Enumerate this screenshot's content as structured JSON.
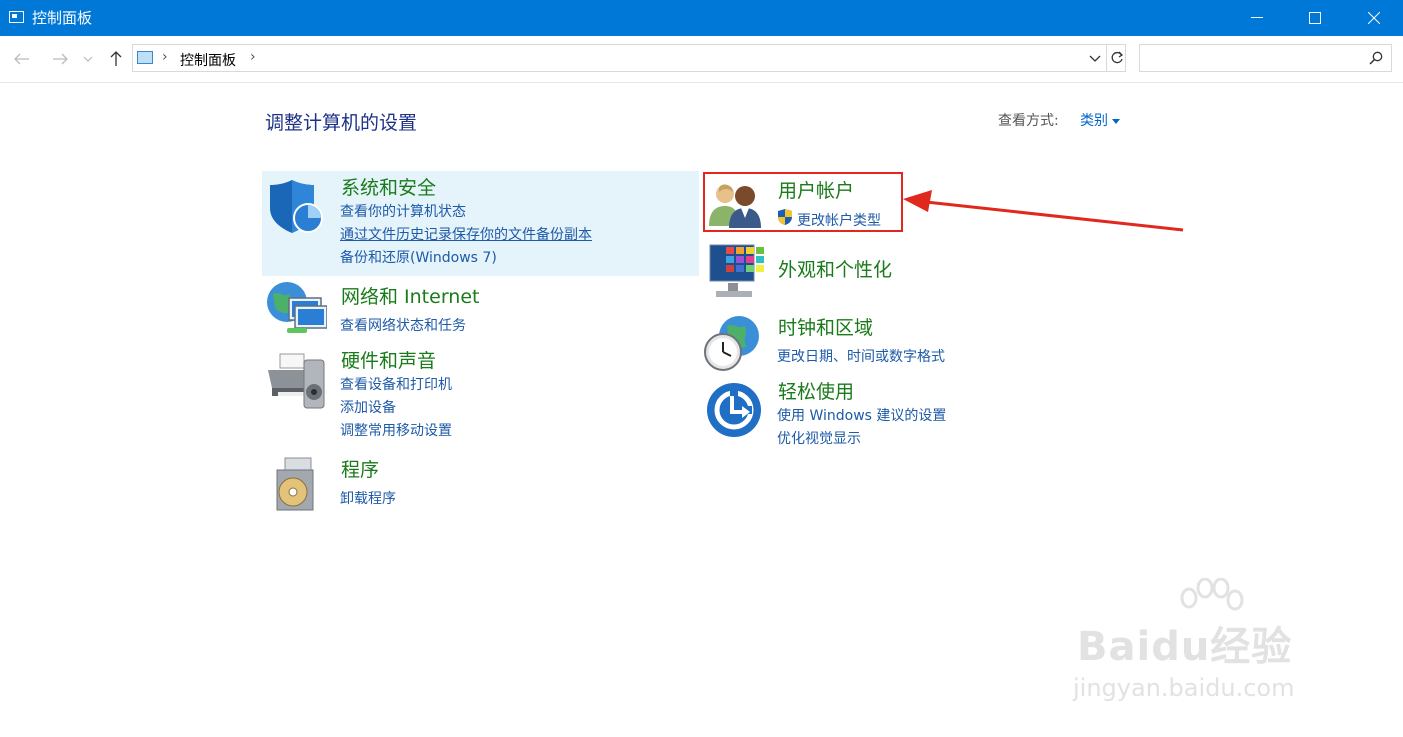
{
  "window": {
    "title": "控制面板"
  },
  "nav": {
    "breadcrumb": "控制面板",
    "search_placeholder": ""
  },
  "content": {
    "heading": "调整计算机的设置",
    "view_by_label": "查看方式:",
    "view_by_value": "类别"
  },
  "categories_left": [
    {
      "title": "系统和安全",
      "links": [
        "查看你的计算机状态",
        "通过文件历史记录保存你的文件备份副本",
        "备份和还原(Windows 7)"
      ]
    },
    {
      "title": "网络和 Internet",
      "links": [
        "查看网络状态和任务"
      ]
    },
    {
      "title": "硬件和声音",
      "links": [
        "查看设备和打印机",
        "添加设备",
        "调整常用移动设置"
      ]
    },
    {
      "title": "程序",
      "links": [
        "卸载程序"
      ]
    }
  ],
  "categories_right": [
    {
      "title": "用户帐户",
      "links": [
        "更改帐户类型"
      ]
    },
    {
      "title": "外观和个性化",
      "links": []
    },
    {
      "title": "时钟和区域",
      "links": [
        "更改日期、时间或数字格式"
      ]
    },
    {
      "title": "轻松使用",
      "links": [
        "使用 Windows 建议的设置",
        "优化视觉显示"
      ]
    }
  ],
  "watermark": {
    "logo": "Baidu经验",
    "url": "jingyan.baidu.com"
  },
  "colors": {
    "titlebar": "#0078d7",
    "category_title": "#1a7b1a",
    "link": "#1e5aa8",
    "highlight_box": "#e0281e"
  }
}
